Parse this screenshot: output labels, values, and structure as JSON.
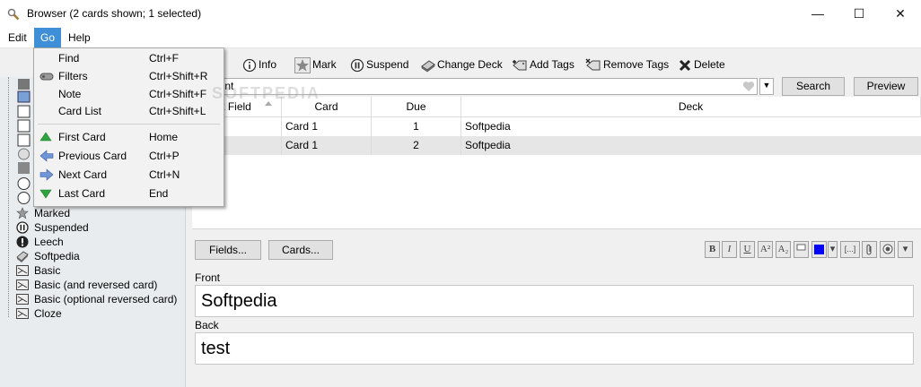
{
  "window": {
    "title": "Browser (2 cards shown; 1 selected)",
    "minimize": "—",
    "maximize": "☐",
    "close": "✕"
  },
  "menubar": {
    "items": [
      "Edit",
      "Go",
      "Help"
    ]
  },
  "go_menu": {
    "items": [
      {
        "label": "Find",
        "shortcut": "Ctrl+F"
      },
      {
        "label": "Filters",
        "shortcut": "Ctrl+Shift+R"
      },
      {
        "label": "Note",
        "shortcut": "Ctrl+Shift+F"
      },
      {
        "label": "Card List",
        "shortcut": "Ctrl+Shift+L"
      },
      {
        "label": "First Card",
        "shortcut": "Home"
      },
      {
        "label": "Previous Card",
        "shortcut": "Ctrl+P"
      },
      {
        "label": "Next Card",
        "shortcut": "Ctrl+N"
      },
      {
        "label": "Last Card",
        "shortcut": "End"
      }
    ]
  },
  "toolbar": {
    "partial": "d",
    "items": [
      "Info",
      "Mark",
      "Suspend",
      "Change Deck",
      "Add Tags",
      "Remove Tags",
      "Delete"
    ]
  },
  "search": {
    "value": "urrent",
    "search_button": "Search",
    "preview_button": "Preview"
  },
  "table": {
    "columns": [
      "t Field",
      "Card",
      "Due",
      "Deck"
    ],
    "rows": [
      {
        "field": "dia",
        "card": "Card 1",
        "due": "1",
        "deck": "Softpedia"
      },
      {
        "field": "dia 1",
        "card": "Card 1",
        "due": "2",
        "deck": "Softpedia"
      }
    ]
  },
  "sidebar": {
    "items": [
      "Marked",
      "Suspended",
      "Leech",
      "Softpedia",
      "Basic",
      "Basic (and reversed card)",
      "Basic (optional reversed card)",
      "Cloze"
    ]
  },
  "editor": {
    "fields_button": "Fields...",
    "cards_button": "Cards...",
    "format_buttons": [
      "B",
      "I",
      "U",
      "A²",
      "A₂",
      "",
      "▾",
      "[...]",
      "",
      "",
      "▾"
    ],
    "color_swatch": "#0000ff",
    "front_label": "Front",
    "front_value": "Softpedia",
    "back_label": "Back",
    "back_value": "test"
  },
  "watermark": "SOFTPEDIA"
}
